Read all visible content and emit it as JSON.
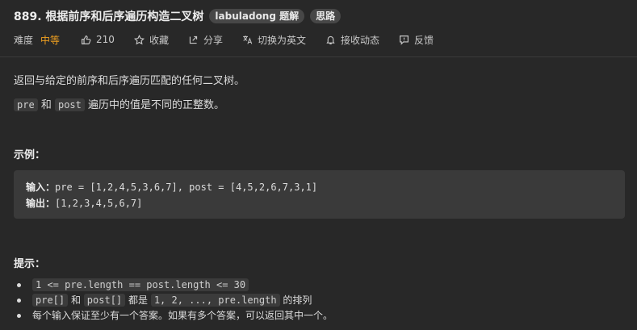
{
  "header": {
    "title": "889. 根据前序和后序遍历构造二叉树",
    "tags": [
      "labuladong 题解",
      "思路"
    ]
  },
  "meta": {
    "difficulty_label": "难度",
    "difficulty_value": "中等",
    "difficulty_color": "#f0a020",
    "likes": "210",
    "favorite": "收藏",
    "share": "分享",
    "translate": "切换为英文",
    "subscribe": "接收动态",
    "feedback": "反馈"
  },
  "description": {
    "line1": "返回与给定的前序和后序遍历匹配的任何二叉树。",
    "line2_code1": "pre",
    "line2_and": "和",
    "line2_code2": "post",
    "line2_rest": "遍历中的值是不同的正整数。"
  },
  "example": {
    "heading": "示例：",
    "input_label": "输入：",
    "input_value": "pre = [1,2,4,5,3,6,7], post = [4,5,2,6,7,3,1]",
    "output_label": "输出：",
    "output_value": "[1,2,3,4,5,6,7]"
  },
  "hints": {
    "heading": "提示：",
    "item1_code": "1 <= pre.length == post.length <= 30",
    "item2_code1": "pre[]",
    "item2_and": "和",
    "item2_code2": "post[]",
    "item2_are": "都是",
    "item2_code3": "1, 2, ..., pre.length",
    "item2_rest": "的排列",
    "item3": "每个输入保证至少有一个答案。如果有多个答案，可以返回其中一个。"
  }
}
